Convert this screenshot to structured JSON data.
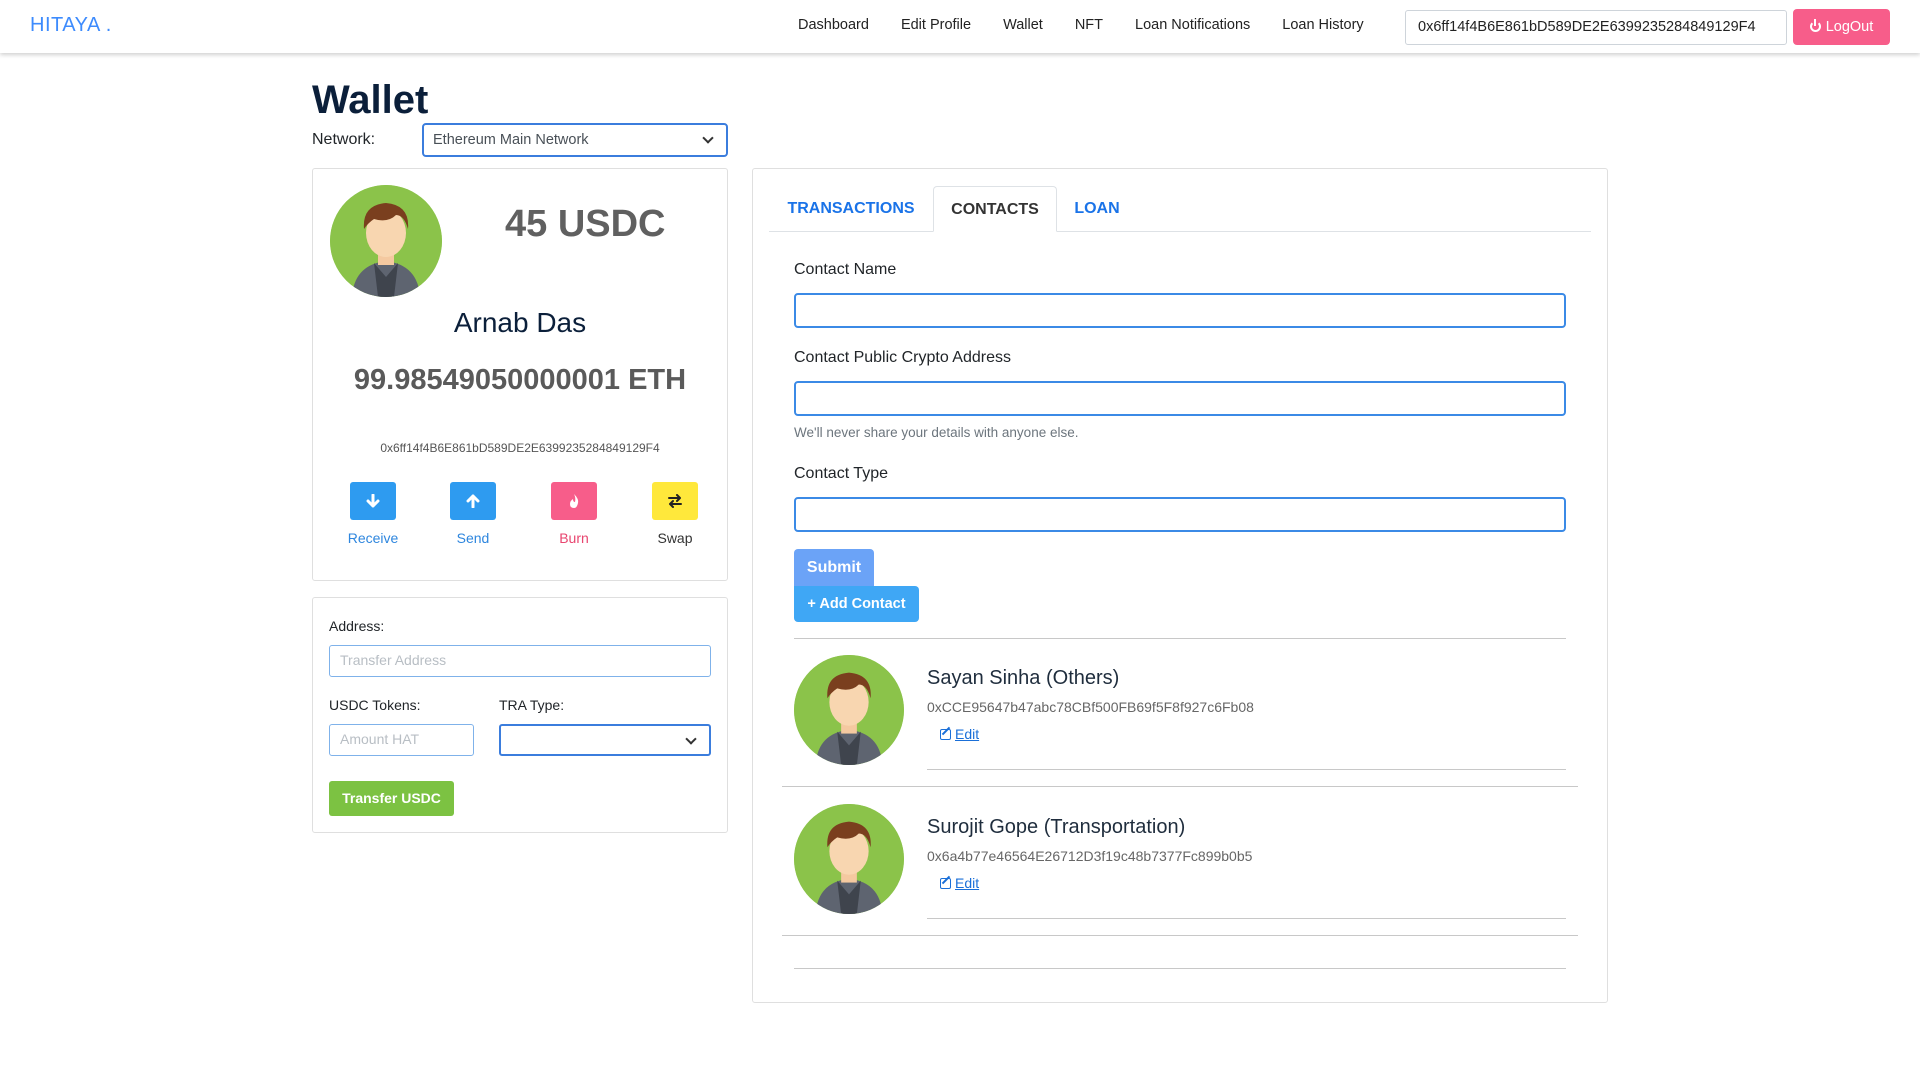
{
  "navbar": {
    "brand": "HITAYA .",
    "links": [
      "Dashboard",
      "Edit Profile",
      "Wallet",
      "NFT",
      "Loan Notifications",
      "Loan History"
    ],
    "wallet_address": "0x6ff14f4B6E861bD589DE2E6399235284849129F4",
    "logout_label": "LogOut"
  },
  "header": {
    "title": "Wallet",
    "network_label": "Network:",
    "network_value": "Ethereum Main Network"
  },
  "profile": {
    "usdc_balance": "45 USDC",
    "name": "Arnab Das",
    "eth_balance": "99.98549050000001 ETH",
    "address": "0x6ff14f4B6E861bD589DE2E6399235284849129F4",
    "actions": [
      {
        "label": "Receive",
        "icon": "arrow-down-icon",
        "color": "#2e9bf0",
        "label_color": "#2e86de"
      },
      {
        "label": "Send",
        "icon": "arrow-up-icon",
        "color": "#2e9bf0",
        "label_color": "#2e86de"
      },
      {
        "label": "Burn",
        "icon": "flame-icon",
        "color": "#f75d8a",
        "label_color": "#e8456f"
      },
      {
        "label": "Swap",
        "icon": "swap-icon",
        "color": "#ffe83b",
        "label_color": "#333333"
      }
    ]
  },
  "transfer": {
    "address_label": "Address:",
    "address_placeholder": "Transfer Address",
    "tokens_label": "USDC Tokens:",
    "tokens_placeholder": "Amount HAT",
    "type_label": "TRA Type:",
    "type_value": "",
    "button_label": "Transfer USDC"
  },
  "tabs": [
    {
      "label": "TRANSACTIONS",
      "active": false
    },
    {
      "label": "CONTACTS",
      "active": true
    },
    {
      "label": "LOAN",
      "active": false
    }
  ],
  "contact_form": {
    "name_label": "Contact Name",
    "address_label": "Contact Public Crypto Address",
    "help_text": "We'll never share your details with anyone else.",
    "type_label": "Contact Type",
    "submit_label": "Submit",
    "add_contact_label": "+ Add Contact"
  },
  "contacts": [
    {
      "name": "Sayan Sinha (Others)",
      "address": "0xCCE95647b47abc78CBf500FB69f5F8f927c6Fb08",
      "edit_label": "Edit"
    },
    {
      "name": "Surojit Gope (Transportation)",
      "address": "0x6a4b77e46564E26712D3f19c48b7377Fc899b0b5",
      "edit_label": "Edit"
    }
  ],
  "colors": {
    "accent": "#3d8bfd",
    "logout": "#f75d8a",
    "transfer_button": "#7cc242",
    "avatar_bg": "#8bc34a"
  }
}
